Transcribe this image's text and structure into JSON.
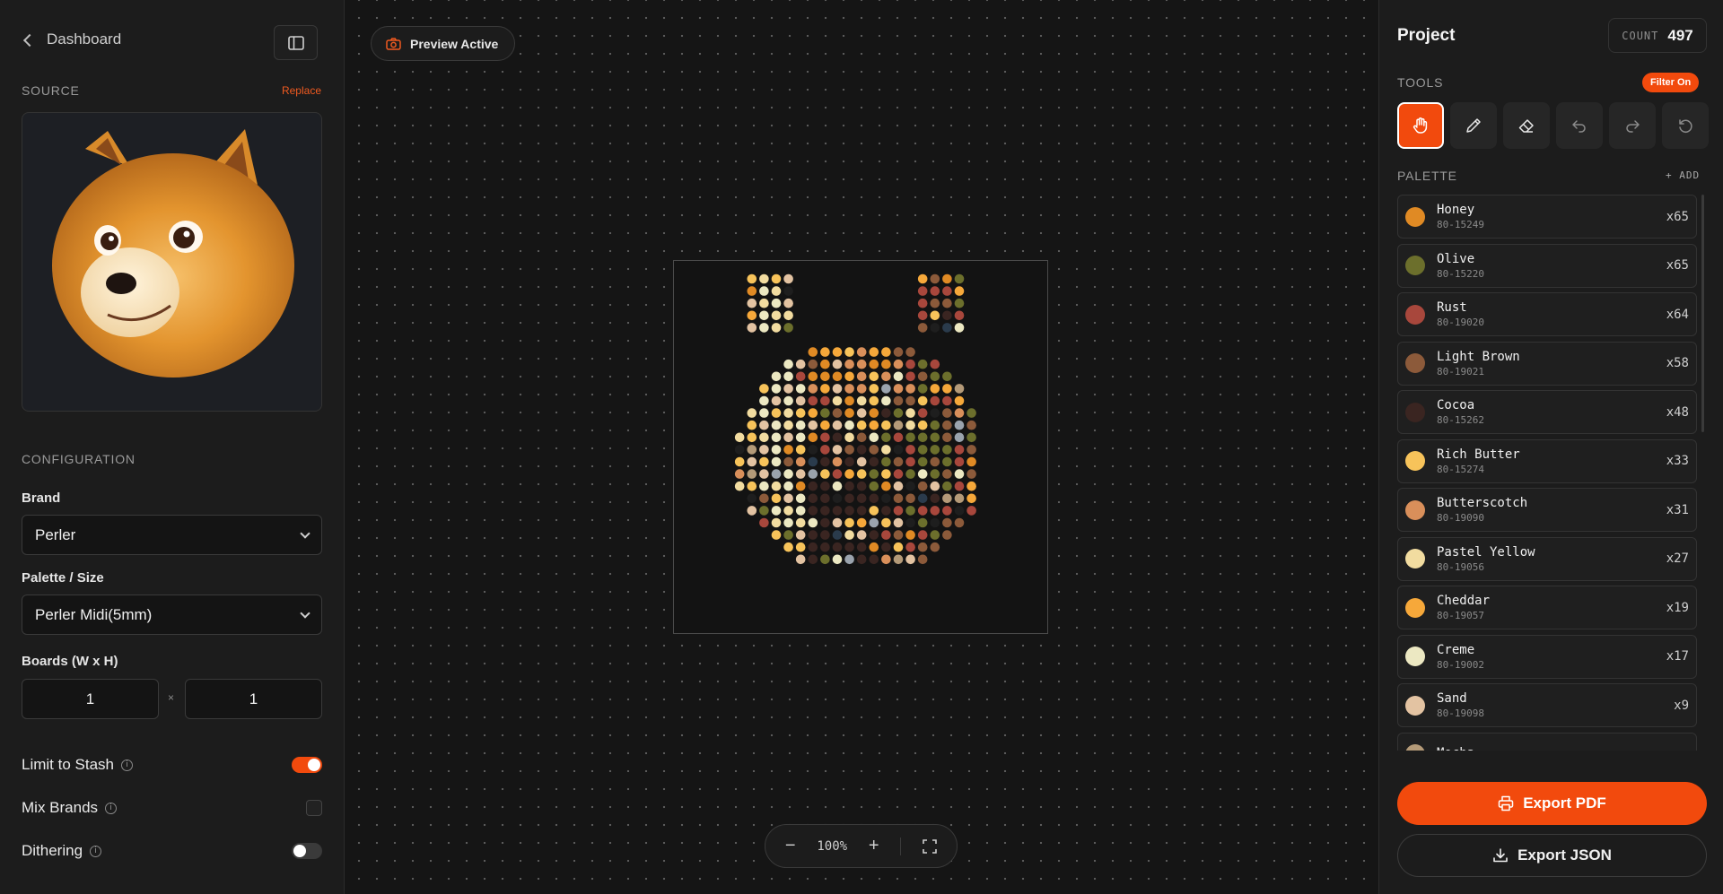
{
  "left": {
    "back_label": "Dashboard",
    "source_label": "SOURCE",
    "replace_label": "Replace",
    "configuration_label": "CONFIGURATION",
    "brand_label": "Brand",
    "brand_value": "Perler",
    "palette_size_label": "Palette / Size",
    "palette_size_value": "Perler Midi(5mm)",
    "boards_label": "Boards (W x H)",
    "boards_w": "1",
    "boards_h": "1",
    "times_symbol": "×",
    "options": {
      "limit_to_stash": {
        "label": "Limit to Stash",
        "on": true
      },
      "mix_brands": {
        "label": "Mix Brands",
        "checked": false
      },
      "dithering": {
        "label": "Dithering",
        "on": false
      }
    }
  },
  "center": {
    "preview_label": "Preview Active",
    "zoom_level": "100%",
    "zoom_out_symbol": "−",
    "zoom_in_symbol": "+"
  },
  "right": {
    "title": "Project",
    "count_key": "COUNT",
    "count_value": "497",
    "tools_label": "TOOLS",
    "filter_badge": "Filter On",
    "tools": [
      "hand-icon",
      "pencil-icon",
      "eraser-icon",
      "undo-icon",
      "redo-icon",
      "reset-icon"
    ],
    "palette_label": "PALETTE",
    "add_label": "+ ADD",
    "palette": [
      {
        "name": "Honey",
        "code": "80-15249",
        "count": "x65",
        "color": "#e08a24"
      },
      {
        "name": "Olive",
        "code": "80-15220",
        "count": "x65",
        "color": "#6c6f2c"
      },
      {
        "name": "Rust",
        "code": "80-19020",
        "count": "x64",
        "color": "#a8473c"
      },
      {
        "name": "Light Brown",
        "code": "80-19021",
        "count": "x58",
        "color": "#8c5a3a"
      },
      {
        "name": "Cocoa",
        "code": "80-15262",
        "count": "x48",
        "color": "#3a2521"
      },
      {
        "name": "Rich Butter",
        "code": "80-15274",
        "count": "x33",
        "color": "#f7c35a"
      },
      {
        "name": "Butterscotch",
        "code": "80-19090",
        "count": "x31",
        "color": "#d98f5a"
      },
      {
        "name": "Pastel Yellow",
        "code": "80-19056",
        "count": "x27",
        "color": "#f2dca0"
      },
      {
        "name": "Cheddar",
        "code": "80-19057",
        "count": "x19",
        "color": "#f6a83a"
      },
      {
        "name": "Creme",
        "code": "80-19002",
        "count": "x17",
        "color": "#ece8c2"
      },
      {
        "name": "Sand",
        "code": "80-19098",
        "count": "x9",
        "color": "#e3c3a2"
      },
      {
        "name": "Mocha",
        "code": "",
        "count": "",
        "color": "#b49a78"
      }
    ],
    "export_pdf": "Export PDF",
    "export_json": "Export JSON"
  },
  "colors": {
    "accent": "#f24a0d",
    "background": "#171717",
    "panel": "#1c1c1c"
  }
}
